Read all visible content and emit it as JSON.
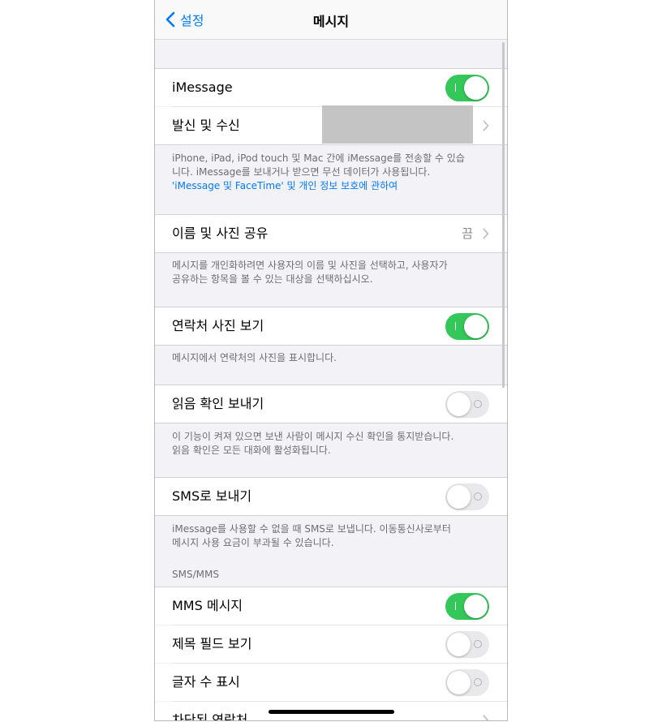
{
  "nav": {
    "back_label": "설정",
    "title": "메시지"
  },
  "rows": {
    "imessage": {
      "label": "iMessage",
      "toggle": true
    },
    "send_receive": {
      "label": "발신 및 수신"
    },
    "name_photo": {
      "label": "이름 및 사진 공유",
      "value": "끔"
    },
    "contact_photos": {
      "label": "연락처 사진 보기",
      "toggle": true
    },
    "read_receipts": {
      "label": "읽음 확인 보내기",
      "toggle": false
    },
    "send_as_sms": {
      "label": "SMS로 보내기",
      "toggle": false
    },
    "mms": {
      "label": "MMS 메시지",
      "toggle": true
    },
    "subject_field": {
      "label": "제목 필드 보기",
      "toggle": false
    },
    "char_count": {
      "label": "글자 수 표시",
      "toggle": false
    },
    "blocked": {
      "label": "차단된 연락처"
    }
  },
  "footers": {
    "imessage_line1": "iPhone, iPad, iPod touch 및 Mac 간에 iMessage를 전송할 수 있습",
    "imessage_line2": "니다. iMessage를 보내거나 받으면 무선 데이터가 사용됩니다.",
    "imessage_link": "'iMessage 및 FaceTime' 및 개인 정보 보호에 관하여",
    "name_photo_line1": "메시지를 개인화하려면 사용자의 이름 및 사진을 선택하고, 사용자가",
    "name_photo_line2": "공유하는 항목을 볼 수 있는 대상을 선택하십시오.",
    "contact_photos": "메시지에서 연락처의 사진을 표시합니다.",
    "read_receipts_line1": "이 기능이 켜져 있으면 보낸 사람이 메시지 수신 확인을 통지받습니다.",
    "read_receipts_line2": "읽음 확인은 모든 대화에 활성화됩니다.",
    "sms_line1": "iMessage를 사용할 수 없을 때 SMS로 보냅니다. 이동통신사로부터",
    "sms_line2": "메시지 사용 요금이 부과될 수 있습니다."
  },
  "section_headers": {
    "sms_mms": "SMS/MMS"
  },
  "colors": {
    "accent": "#007aff",
    "toggle_on": "#34c759",
    "toggle_off": "#e9e9eb",
    "background": "#f2f2f7"
  }
}
